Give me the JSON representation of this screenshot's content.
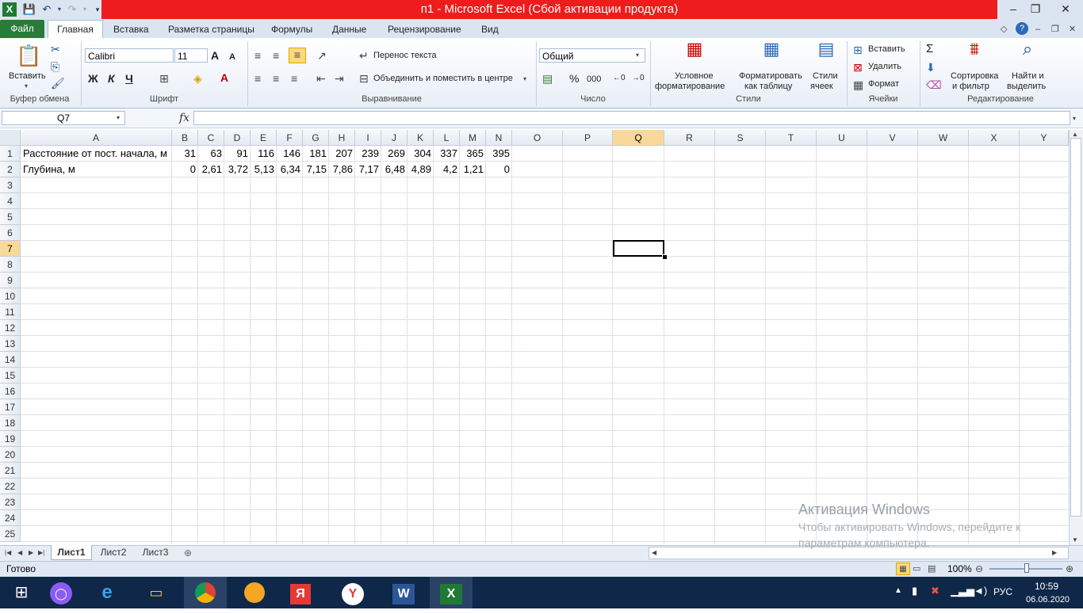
{
  "window": {
    "title": "п1  -  Microsoft Excel (Сбой активации продукта)",
    "minimize": "–",
    "restore": "❐",
    "close": "✕"
  },
  "tabs": [
    "Файл",
    "Главная",
    "Вставка",
    "Разметка страницы",
    "Формулы",
    "Данные",
    "Рецензирование",
    "Вид"
  ],
  "ribbon": {
    "clipboard": {
      "paste": "Вставить",
      "label": "Буфер обмена"
    },
    "font": {
      "name": "Calibri",
      "size": "11",
      "bold": "Ж",
      "italic": "К",
      "underline": "Ч",
      "label": "Шрифт"
    },
    "alignment": {
      "wrap": "Перенос текста",
      "merge": "Объединить и поместить в центре",
      "label": "Выравнивание"
    },
    "number": {
      "format": "Общий",
      "percent": "%",
      "thousands": "000",
      "label": "Число"
    },
    "styles": {
      "conditional_1": "Условное",
      "conditional_2": "форматирование",
      "table_1": "Форматировать",
      "table_2": "как таблицу",
      "cell_1": "Стили",
      "cell_2": "ячеек",
      "label": "Стили"
    },
    "cells": {
      "insert": "Вставить",
      "delete": "Удалить",
      "format": "Формат",
      "label": "Ячейки"
    },
    "editing": {
      "sort_1": "Сортировка",
      "sort_2": "и фильтр",
      "find_1": "Найти и",
      "find_2": "выделить",
      "label": "Редактирование"
    }
  },
  "formula_bar": {
    "name_box": "Q7",
    "fx": "fx",
    "value": ""
  },
  "columns": [
    "A",
    "B",
    "C",
    "D",
    "E",
    "F",
    "G",
    "H",
    "I",
    "J",
    "K",
    "L",
    "M",
    "N",
    "O",
    "P",
    "Q",
    "R",
    "S",
    "T",
    "U",
    "V",
    "W",
    "X",
    "Y"
  ],
  "rows": [
    "1",
    "2",
    "3",
    "4",
    "5",
    "6",
    "7",
    "8",
    "9",
    "10",
    "11",
    "12",
    "13",
    "14",
    "15",
    "16",
    "17",
    "18",
    "19",
    "20",
    "21",
    "22",
    "23",
    "24",
    "25"
  ],
  "cells": {
    "row1": {
      "label": "Расстояние от пост. начала, м",
      "values": [
        "31",
        "63",
        "91",
        "116",
        "146",
        "181",
        "207",
        "239",
        "269",
        "304",
        "337",
        "365",
        "395"
      ]
    },
    "row2": {
      "label": "Глубина, м",
      "values": [
        "0",
        "2,61",
        "3,72",
        "5,13",
        "6,34",
        "7,15",
        "7,86",
        "7,17",
        "6,48",
        "4,89",
        "4,2",
        "1,21",
        "0"
      ]
    }
  },
  "sheets": [
    "Лист1",
    "Лист2",
    "Лист3"
  ],
  "status": {
    "ready": "Готово",
    "zoom": "100%"
  },
  "watermark": {
    "title": "Активация Windows",
    "line1": "Чтобы активировать Windows, перейдите к",
    "line2": "параметрам компьютера."
  },
  "taskbar": {
    "lang": "РУС",
    "time": "10:59",
    "date": "06.06.2020"
  }
}
